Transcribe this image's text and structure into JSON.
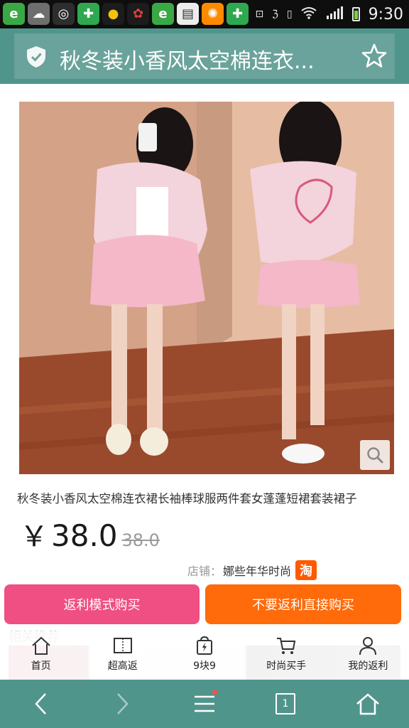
{
  "status_bar": {
    "time": "9:30",
    "app_icons": [
      "ie-browser-icon",
      "cloud-icon",
      "glasses-icon",
      "game-controller-icon",
      "chat-bubble-icon",
      "color-wheel-icon",
      "ie-browser-icon",
      "news-icon",
      "pinwheel-icon",
      "game-controller-icon"
    ],
    "status_icons": [
      "screenshot-icon",
      "nfc-icon",
      "vibrate-icon",
      "wifi-icon",
      "signal-icon",
      "battery-icon"
    ]
  },
  "header": {
    "title": "秋冬装小香风太空棉连衣...",
    "shield_icon": "shield-check-icon",
    "favorite_icon": "star-outline-icon"
  },
  "product": {
    "image_alt": "product-photo",
    "title": "秋冬装小香风太空棉连衣裙长袖棒球服两件套女蓬蓬短裙套装裙子",
    "price_symbol": "￥",
    "price": "38.0",
    "original_price": "38.0",
    "shop_label": "店铺：",
    "shop_name": "娜些年华时尚",
    "shop_badge": "淘"
  },
  "actions": {
    "rebate_buy": "返利模式购买",
    "direct_buy": "不要返利直接购买"
  },
  "related": {
    "heading": "相关推荐"
  },
  "tabbar": {
    "items": [
      {
        "label": "首页",
        "icon": "home-icon"
      },
      {
        "label": "超高返",
        "icon": "film-icon"
      },
      {
        "label": "9块9",
        "icon": "lightning-bag-icon"
      },
      {
        "label": "时尚买手",
        "icon": "cart-icon"
      },
      {
        "label": "我的返利",
        "icon": "user-icon"
      }
    ]
  },
  "navbar": {
    "tabs_count": "1"
  },
  "colors": {
    "header_bg": "#50958c",
    "rebate_button": "#ef4f82",
    "direct_button": "#ff6a0a",
    "taobao_badge": "#ff5a00"
  }
}
